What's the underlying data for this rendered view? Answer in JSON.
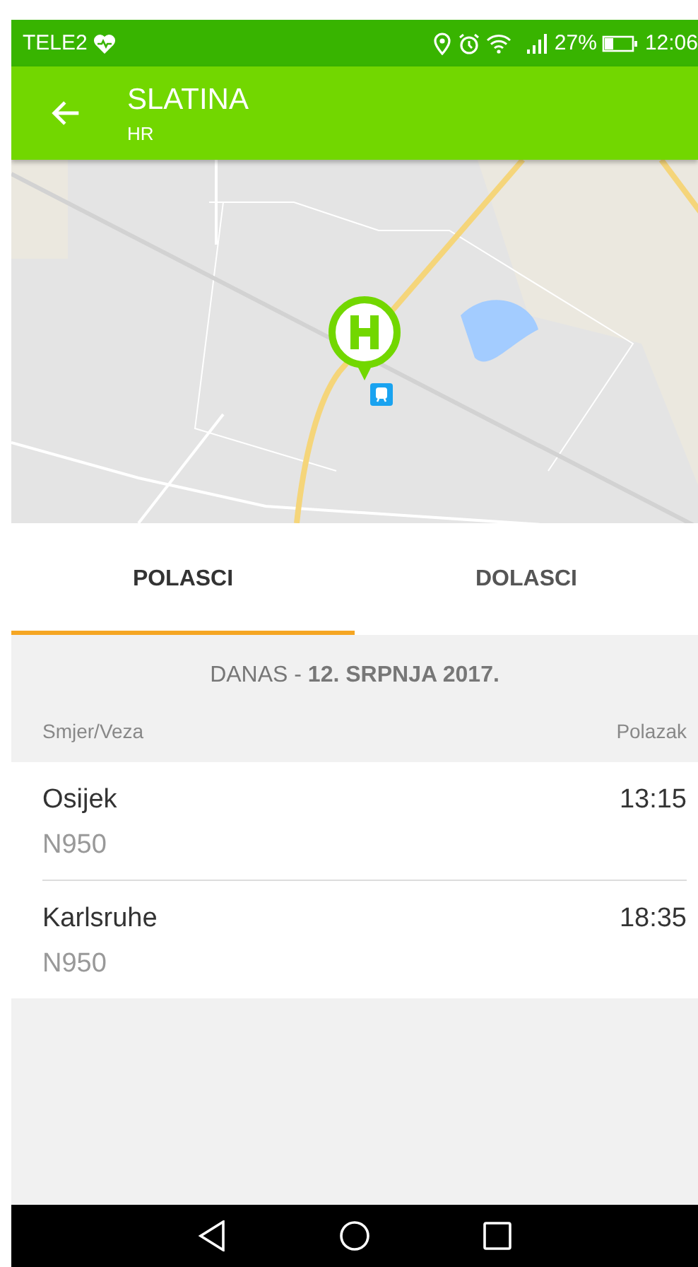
{
  "status_bar": {
    "carrier": "TELE2",
    "battery": "27%",
    "time": "12:06"
  },
  "app_bar": {
    "title": "SLATINA",
    "subtitle": "HR"
  },
  "tabs": [
    {
      "label": "POLASCI",
      "selected": true
    },
    {
      "label": "DOLASCI",
      "selected": false
    }
  ],
  "date_header": "DANAS - **12. SRPNJA 2017.**",
  "columns": [
    "Smjer/Veza",
    "Polazak"
  ],
  "departures": [
    {
      "destination": "Osijek",
      "line": "N950",
      "time": "13:15"
    },
    {
      "destination": "Karlsruhe",
      "line": "N950",
      "time": "18:35"
    }
  ]
}
